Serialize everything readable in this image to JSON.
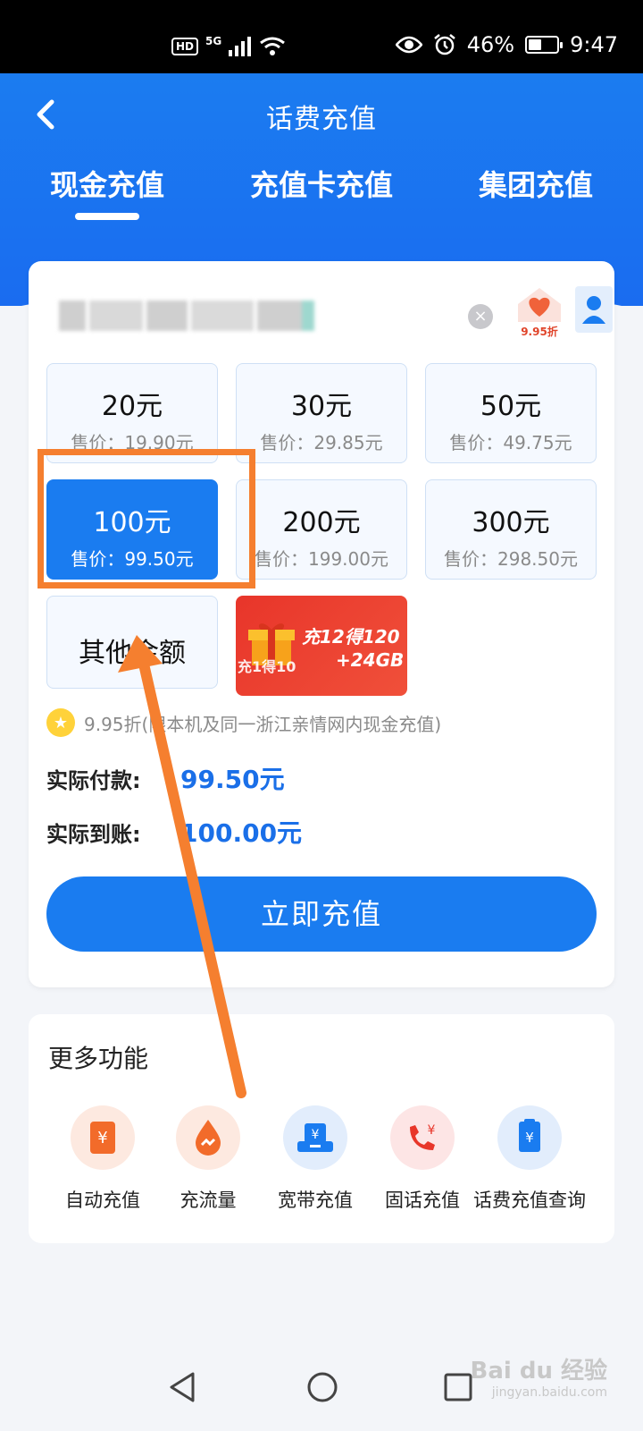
{
  "status_bar": {
    "hd": "HD",
    "network": "5G",
    "battery_text": "46%",
    "battery_level": 0.46,
    "time": "9:47"
  },
  "header": {
    "title": "话费充值",
    "tabs": [
      {
        "label": "现金充值",
        "active": true
      },
      {
        "label": "充值卡充值",
        "active": false
      },
      {
        "label": "集团充值",
        "active": false
      }
    ]
  },
  "phone": {
    "discount_badge": "9.95折"
  },
  "amounts": [
    {
      "face": "20元",
      "price": "售价：19.90元"
    },
    {
      "face": "30元",
      "price": "售价：29.85元"
    },
    {
      "face": "50元",
      "price": "售价：49.75元"
    },
    {
      "face": "100元",
      "price": "售价：99.50元",
      "selected": true
    },
    {
      "face": "200元",
      "price": "售价：199.00元"
    },
    {
      "face": "300元",
      "price": "售价：298.50元"
    }
  ],
  "other_amount": "其他金额",
  "promo": {
    "line1": "充12得120",
    "line2": "+24GB",
    "corner": "充1得10"
  },
  "note": "9.95折(限本机及同一浙江亲情网内现金充值)",
  "payment": {
    "actual_pay_label": "实际付款:",
    "actual_pay_value": "99.50元",
    "actual_receive_label": "实际到账:",
    "actual_receive_value": "100.00元"
  },
  "submit_label": "立即充值",
  "more": {
    "title": "更多功能",
    "items": [
      {
        "label": "自动充值",
        "icon": "yuan-card-icon"
      },
      {
        "label": "充流量",
        "icon": "data-drop-icon"
      },
      {
        "label": "宽带充值",
        "icon": "broadband-icon"
      },
      {
        "label": "固话充值",
        "icon": "phone-yuan-icon"
      },
      {
        "label": "话费充值查询",
        "icon": "clipboard-yuan-icon"
      }
    ]
  },
  "watermark": {
    "brand": "Bai du 经验",
    "url": "jingyan.baidu.com"
  },
  "colors": {
    "primary": "#1a7cf0",
    "highlight": "#f57f2f",
    "price_blue": "#1a6fe8"
  }
}
